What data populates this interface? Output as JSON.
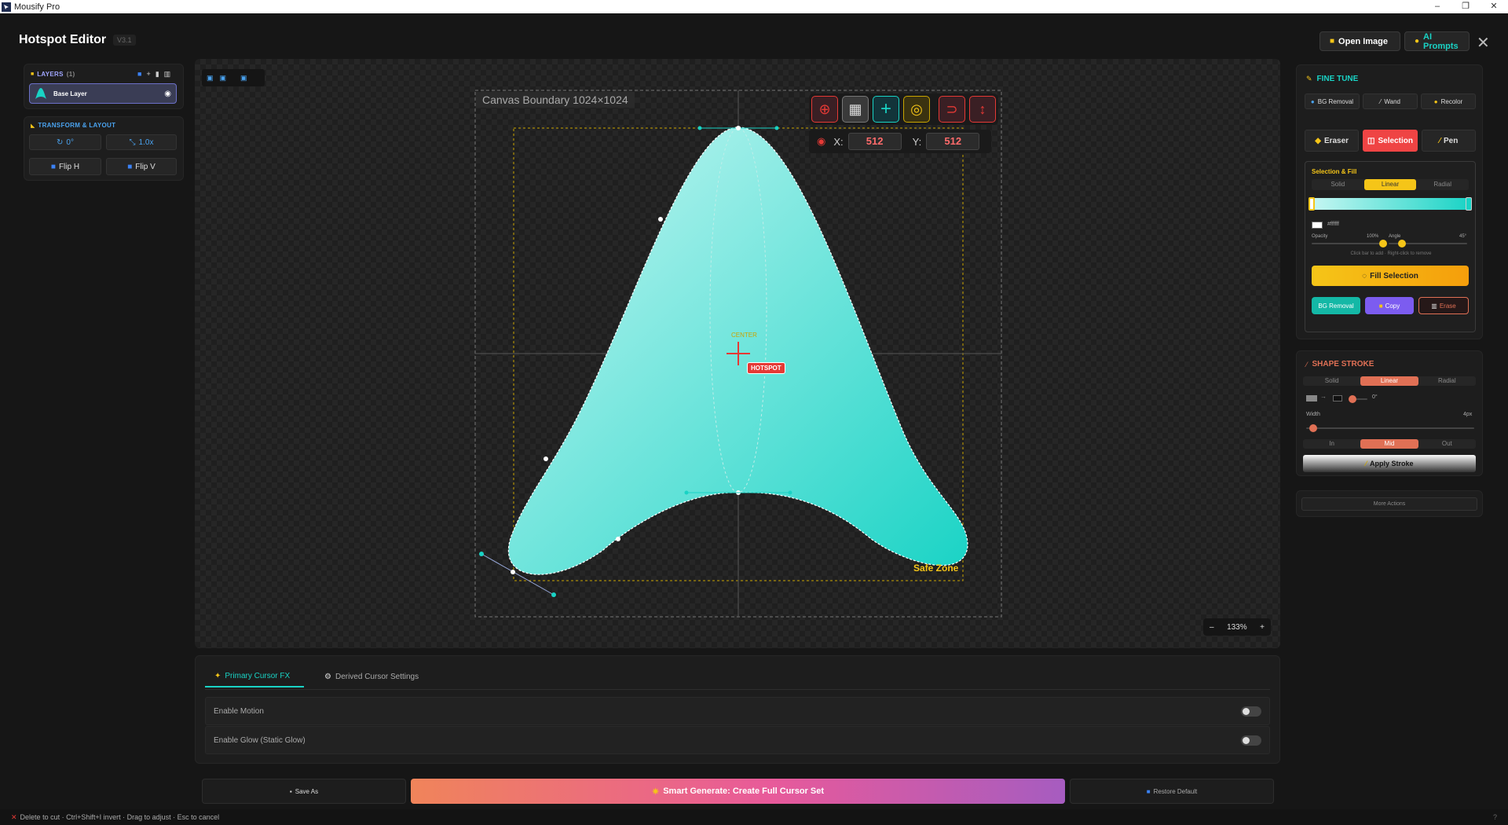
{
  "window": {
    "title": "Mousify Pro",
    "minimize": "–",
    "maximize": "❐",
    "close": "✕"
  },
  "header": {
    "title": "Hotspot Editor",
    "version": "V3.1",
    "open_image": "Open Image",
    "ai_prompts": "AI Prompts",
    "close": "✕"
  },
  "layers": {
    "title": "LAYERS",
    "count": "(1)",
    "item": "Base Layer"
  },
  "transform": {
    "title": "TRANSFORM & LAYOUT",
    "rotation": "0°",
    "scale": "1.0x",
    "flip_h": "Flip H",
    "flip_v": "Flip V"
  },
  "canvas": {
    "boundary_label": "Canvas Boundary 1024×1024",
    "coord_x_label": "X:",
    "coord_x": "512",
    "coord_y_label": "Y:",
    "coord_y": "512",
    "hotspot_label": "HOTSPOT",
    "center_label": "CENTER",
    "safe_zone": "Safe Zone",
    "zoom": "133%",
    "zoom_minus": "–",
    "zoom_plus": "+",
    "fill_color_top": "#c8f7f3",
    "fill_color_bottom": "#19d3c5"
  },
  "fine_tune": {
    "title": "FINE TUNE",
    "tabs": [
      "BG Removal",
      "Wand",
      "Recolor"
    ],
    "tools": [
      "Eraser",
      "Selection",
      "Pen"
    ],
    "sel_title": "Selection & Fill",
    "fill_modes": [
      "Solid",
      "Linear",
      "Radial"
    ],
    "color_hex": "#ffffff",
    "opacity_label": "Opacity",
    "opacity_value": "100%",
    "opacity": 1.0,
    "angle_label": "Angle",
    "angle_value": "45°",
    "hint": "Click bar to add · Right-click to remove",
    "fill_button": "Fill Selection",
    "bg_removal": "BG Removal",
    "copy": "Copy",
    "erase": "Erase"
  },
  "shape_stroke": {
    "title": "SHAPE STROKE",
    "modes": [
      "Solid",
      "Linear",
      "Radial"
    ],
    "angle_value": "0°",
    "width_label": "Width",
    "width_value": "4px",
    "positions": [
      "In",
      "Mid",
      "Out"
    ],
    "apply": "Apply Stroke"
  },
  "more_actions": "More Actions",
  "bottom_tabs": {
    "primary": "Primary Cursor FX",
    "derived": "Derived Cursor Settings"
  },
  "settings": {
    "motion": "Enable Motion",
    "glow": "Enable Glow (Static Glow)"
  },
  "actions": {
    "save_as": "Save As",
    "smart_generate": "Smart Generate: Create Full Cursor Set",
    "restore": "Restore Default"
  },
  "status": {
    "text": "Delete to cut · Ctrl+Shift+I invert · Drag to adjust · Esc to cancel",
    "help": "?"
  }
}
